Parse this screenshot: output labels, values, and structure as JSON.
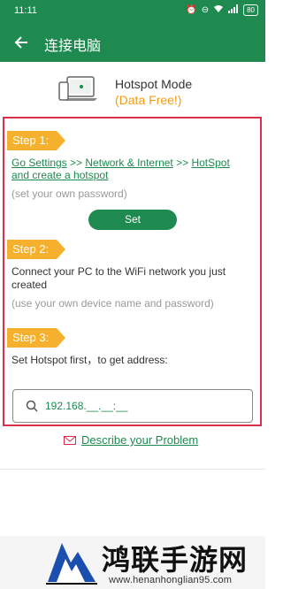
{
  "status_bar": {
    "time": "11:11",
    "battery": "80"
  },
  "app_bar": {
    "title": "连接电脑",
    "back_icon": "arrow-left-icon"
  },
  "hero": {
    "title": "Hotspot Mode",
    "subtitle": "(Data Free!)"
  },
  "step1": {
    "tag": "Step 1:",
    "link_go_settings": "Go Settings",
    "sep1": " >> ",
    "link_network": "Network & Internet",
    "sep2": " >> ",
    "link_hotspot": "HotSpot",
    "line2": "and create a hotspot",
    "hint": "(set your own password)",
    "button": "Set"
  },
  "step2": {
    "tag": "Step 2:",
    "text": "Connect your PC to the WiFi network you just created",
    "hint": "(use your own device name and password)"
  },
  "step3": {
    "tag": "Step 3:",
    "text": "Set Hotspot first，to get address:",
    "address": "192.168.__.__:__"
  },
  "problem_link": "Describe your Problem",
  "watermark": {
    "cn": "鸿联手游网",
    "url": "www.henanhonglian95.com"
  },
  "colors": {
    "primary": "#1e8a4f",
    "accent": "#f5b12e",
    "highlight_border": "#d9304b",
    "subtitle": "#f39c12"
  }
}
